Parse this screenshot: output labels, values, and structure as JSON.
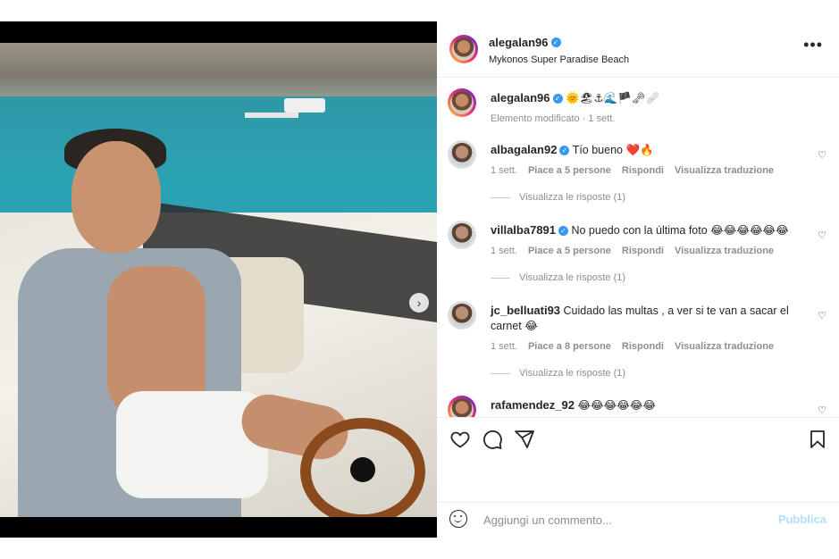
{
  "post": {
    "username": "alegalan96",
    "location": "Mykonos Super Paradise Beach"
  },
  "caption": {
    "username": "alegalan96",
    "text": "🌞🏖⚓🌊🏴🗝🩹",
    "meta": "Elemento modificato · 1 sett."
  },
  "comments": [
    {
      "username": "albagalan92",
      "verified": true,
      "text": "Tío bueno ❤️🔥",
      "time": "1 sett.",
      "likes": "Piace a 5 persone",
      "reply": "Rispondi",
      "translate": "Visualizza traduzione",
      "replies": "Visualizza le risposte (1)"
    },
    {
      "username": "villalba7891",
      "verified": true,
      "text": "No puedo con la última foto 😂😂😂😂😂😂",
      "time": "1 sett.",
      "likes": "Piace a 5 persone",
      "reply": "Rispondi",
      "translate": "Visualizza traduzione",
      "replies": "Visualizza le risposte (1)"
    },
    {
      "username": "jc_belluati93",
      "verified": false,
      "text": "Cuidado las multas , a ver si te van a sacar el carnet 😂",
      "time": "1 sett.",
      "likes": "Piace a 8 persone",
      "reply": "Rispondi",
      "translate": "Visualizza traduzione",
      "replies": "Visualizza le risposte (1)"
    },
    {
      "username": "rafamendez_92",
      "verified": false,
      "text": "😂😂😂😂😂😂"
    }
  ],
  "add_comment": {
    "placeholder": "Aggiungi un commento...",
    "publish": "Pubblica"
  },
  "colors": {
    "verified": "#3897f0",
    "publish_disabled": "#b2dffc",
    "meta_gray": "#8e8e8e"
  },
  "icons": [
    "more-options-icon",
    "heart-icon",
    "comment-icon",
    "share-icon",
    "bookmark-icon",
    "emoji-icon",
    "next-arrow-icon"
  ]
}
